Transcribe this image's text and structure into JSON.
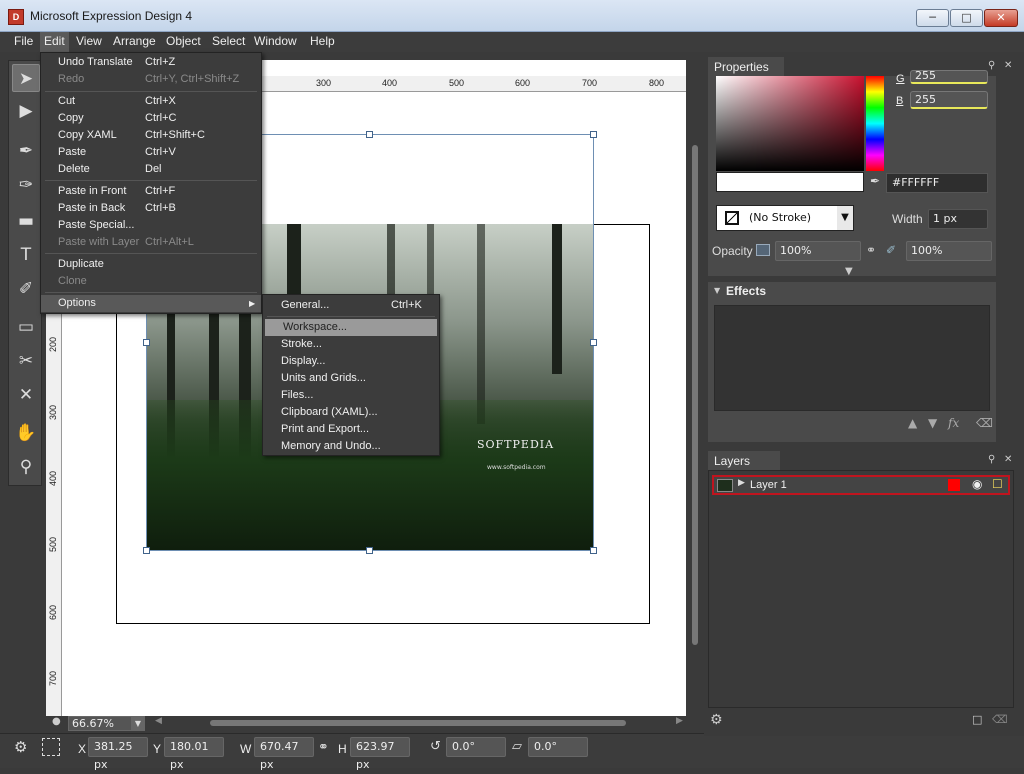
{
  "window": {
    "title": "Microsoft Expression Design 4",
    "icon_glyph": "D"
  },
  "menubar": [
    "File",
    "Edit",
    "View",
    "Arrange",
    "Object",
    "Select",
    "Window",
    "Help"
  ],
  "edit_menu": {
    "items": [
      {
        "label": "Undo Translate",
        "shortcut": "Ctrl+Z",
        "enabled": true
      },
      {
        "label": "Redo",
        "shortcut": "Ctrl+Y, Ctrl+Shift+Z",
        "enabled": false
      },
      {
        "label": "Cut",
        "shortcut": "Ctrl+X",
        "enabled": true
      },
      {
        "label": "Copy",
        "shortcut": "Ctrl+C",
        "enabled": true
      },
      {
        "label": "Copy XAML",
        "shortcut": "Ctrl+Shift+C",
        "enabled": true
      },
      {
        "label": "Paste",
        "shortcut": "Ctrl+V",
        "enabled": true
      },
      {
        "label": "Delete",
        "shortcut": "Del",
        "enabled": true
      },
      {
        "label": "Paste in Front",
        "shortcut": "Ctrl+F",
        "enabled": true
      },
      {
        "label": "Paste in Back",
        "shortcut": "Ctrl+B",
        "enabled": true
      },
      {
        "label": "Paste Special...",
        "shortcut": "",
        "enabled": true
      },
      {
        "label": "Paste with Layer",
        "shortcut": "Ctrl+Alt+L",
        "enabled": false
      },
      {
        "label": "Duplicate",
        "shortcut": "",
        "enabled": true
      },
      {
        "label": "Clone",
        "shortcut": "",
        "enabled": false
      },
      {
        "label": "Options",
        "shortcut": "",
        "enabled": true
      }
    ]
  },
  "options_menu": {
    "items": [
      {
        "label": "General...",
        "shortcut": "Ctrl+K"
      },
      {
        "label": "Workspace...",
        "shortcut": ""
      },
      {
        "label": "Stroke...",
        "shortcut": ""
      },
      {
        "label": "Display...",
        "shortcut": ""
      },
      {
        "label": "Units and Grids...",
        "shortcut": ""
      },
      {
        "label": "Files...",
        "shortcut": ""
      },
      {
        "label": "Clipboard (XAML)...",
        "shortcut": ""
      },
      {
        "label": "Print and Export...",
        "shortcut": ""
      },
      {
        "label": "Memory and Undo...",
        "shortcut": ""
      }
    ]
  },
  "tools": [
    "selection-icon",
    "direct-selection-icon",
    "paintbrush-icon",
    "pen-icon",
    "rectangle-icon",
    "text-icon",
    "b-spline-icon",
    "eraser-icon",
    "scissors-icon",
    "eyedropper-icon",
    "hand-icon",
    "zoom-icon"
  ],
  "rulers": {
    "horizontal": [
      "300",
      "400",
      "500",
      "600",
      "700",
      "800"
    ],
    "vertical": [
      "200",
      "300",
      "400",
      "500",
      "600",
      "700"
    ]
  },
  "canvas": {
    "photo_logo": "SOFTPEDIA",
    "photo_url": "www.softpedia.com",
    "zoom": "66.67%"
  },
  "status": {
    "x_label": "X",
    "x_value": "381.25 px",
    "y_label": "Y",
    "y_value": "180.01 px",
    "w_label": "W",
    "w_value": "670.47 px",
    "h_label": "H",
    "h_value": "623.97 px",
    "rotation": "0.0°",
    "skew": "0.0°"
  },
  "properties": {
    "tab": "Properties",
    "g_label": "G",
    "g_value": "255",
    "b_label": "B",
    "b_value": "255",
    "hex": "#FFFFFF",
    "stroke": "(No Stroke)",
    "width_label": "Width",
    "width_value": "1 px",
    "opacity_label": "Opacity",
    "opacity_value": "100%",
    "opacity_value2": "100%"
  },
  "effects": {
    "title": "Effects",
    "fx_label": "fx"
  },
  "layers": {
    "tab": "Layers",
    "items": [
      {
        "name": "Layer 1",
        "color": "#ff0000"
      }
    ]
  },
  "colors": {
    "accent_red": "#c0141e",
    "panel": "#4a4a4a",
    "menu_bg": "#3c3c3c"
  }
}
